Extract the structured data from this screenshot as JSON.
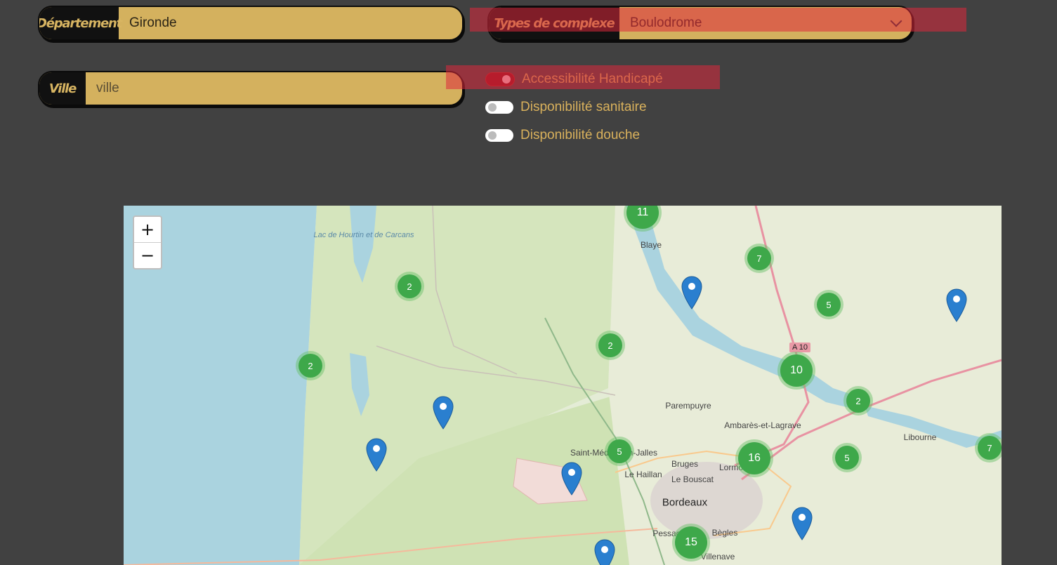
{
  "filters": {
    "departement": {
      "label": "Département",
      "value": "Gironde"
    },
    "ville": {
      "label": "Ville",
      "placeholder": "ville"
    },
    "types": {
      "label": "Types de complexe",
      "value": "Boulodrome"
    },
    "toggles": [
      {
        "label": "Accessibilité Handicapé",
        "on": true
      },
      {
        "label": "Disponibilité sanitaire",
        "on": false
      },
      {
        "label": "Disponibilité douche",
        "on": false
      }
    ]
  },
  "map": {
    "zoom_in": "+",
    "zoom_out": "−",
    "clusters": [
      "11",
      "7",
      "2",
      "5",
      "2",
      "2",
      "10",
      "2",
      "5",
      "16",
      "5",
      "7",
      "15"
    ],
    "places": [
      "Lac de Hourtin et de Carcans",
      "Blaye",
      "Parempuyre",
      "Ambarès-et-Lagrave",
      "Libourne",
      "Saint-Médard-en-Jalles",
      "Le Haillan",
      "Bruges",
      "Le Bouscat",
      "Lormont",
      "Bordeaux",
      "Pessac",
      "Bègles",
      "Villenave",
      "A 10"
    ]
  },
  "colors": {
    "accent": "#d4b15e",
    "cluster": "#3ea84a",
    "pin": "#2a7fcf",
    "highlight": "#dc283c"
  }
}
